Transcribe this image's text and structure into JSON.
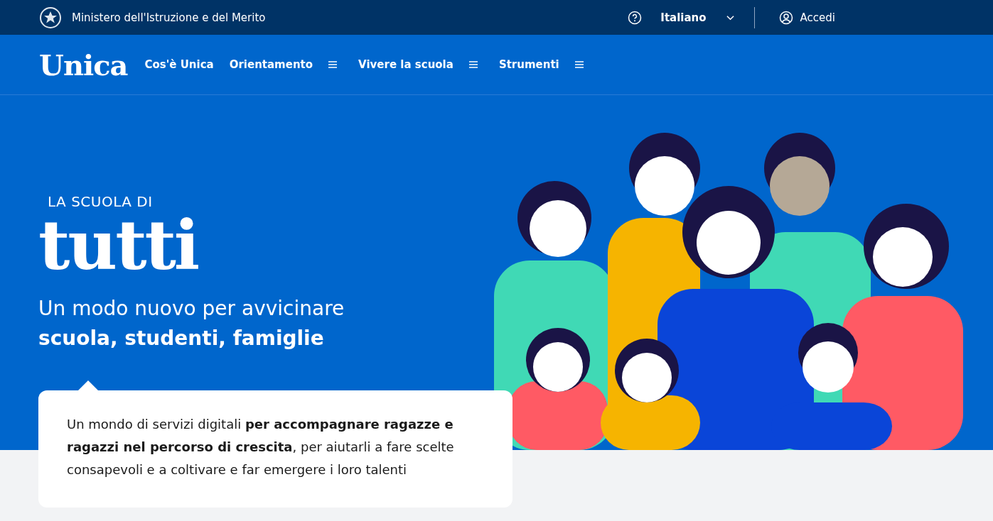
{
  "top_bar": {
    "ministry": "Ministero dell'Istruzione e del Merito",
    "language": "Italiano",
    "login": "Accedi"
  },
  "header": {
    "logo": "Unica",
    "nav": [
      {
        "label": "Cos'è Unica",
        "has_menu": false
      },
      {
        "label": "Orientamento",
        "has_menu": true
      },
      {
        "label": "Vivere la scuola",
        "has_menu": true
      },
      {
        "label": "Strumenti",
        "has_menu": true
      }
    ]
  },
  "hero": {
    "eyebrow": "LA SCUOLA DI",
    "title": "tutti",
    "subtitle": "Un modo nuovo per avvicinare\n**scuola, studenti, famiglie**"
  },
  "card": {
    "text": "Un mondo di servizi digitali **per accompagnare ragazze e ragazzi nel percorso di crescita**, per aiutarli a fare scelte consapevoli e a coltivare e far emergere i loro talenti"
  }
}
